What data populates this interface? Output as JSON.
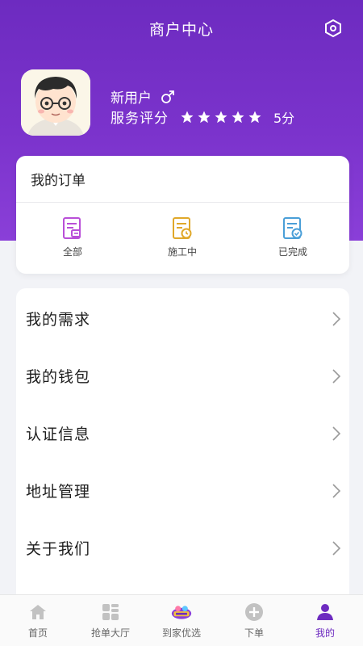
{
  "header": {
    "title": "商户中心"
  },
  "profile": {
    "name": "新用户",
    "gender_icon": "male-icon",
    "rating_label": "服务评分",
    "rating_stars": 5,
    "score": "5分"
  },
  "orders": {
    "title": "我的订单",
    "items": [
      {
        "label": "全部",
        "icon": "document-icon",
        "color": "#b94fd8"
      },
      {
        "label": "施工中",
        "icon": "document-clock-icon",
        "color": "#e0a82a"
      },
      {
        "label": "已完成",
        "icon": "document-check-icon",
        "color": "#4a9fd8"
      }
    ]
  },
  "menu": {
    "items": [
      {
        "label": "我的需求"
      },
      {
        "label": "我的钱包"
      },
      {
        "label": "认证信息"
      },
      {
        "label": "地址管理"
      },
      {
        "label": "关于我们"
      }
    ]
  },
  "tabbar": {
    "items": [
      {
        "label": "首页",
        "icon": "home-icon"
      },
      {
        "label": "抢单大厅",
        "icon": "grid-icon"
      },
      {
        "label": "到家优选",
        "icon": "promo-badge-icon"
      },
      {
        "label": "下单",
        "icon": "plus-circle-icon"
      },
      {
        "label": "我的",
        "icon": "user-icon"
      }
    ],
    "active_index": 4
  },
  "colors": {
    "brand": "#6d2bc0",
    "active_tab": "#6d2bc0"
  }
}
